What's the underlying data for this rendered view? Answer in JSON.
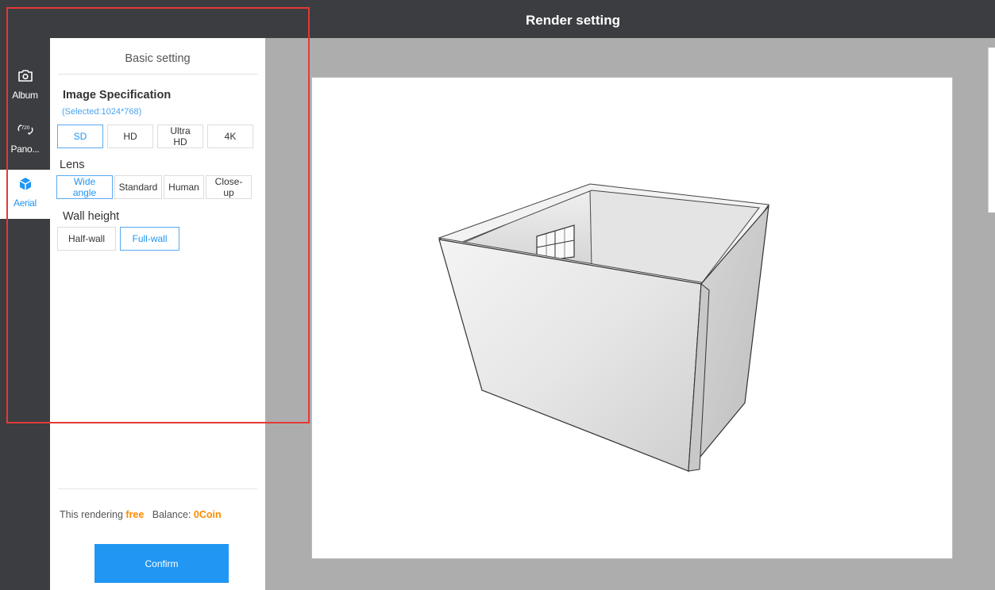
{
  "header": {
    "title": "Render setting"
  },
  "nav": {
    "items": [
      {
        "label": "Album",
        "icon": "camera-icon"
      },
      {
        "label": "Pano...",
        "icon": "rotate-720-icon",
        "icon_text": "720"
      },
      {
        "label": "Aerial",
        "icon": "cube-icon"
      }
    ],
    "active_index": 2
  },
  "panel": {
    "title": "Basic setting",
    "image_spec": {
      "heading": "Image Specification",
      "selected_note": "(Selected:1024*768)",
      "options": [
        "SD",
        "HD",
        "Ultra HD",
        "4K"
      ],
      "selected": "SD"
    },
    "lens": {
      "heading": "Lens",
      "options": [
        "Wide angle",
        "Standard",
        "Human",
        "Close-up"
      ],
      "selected": "Wide angle"
    },
    "wall_height": {
      "heading": "Wall height",
      "options": [
        "Half-wall",
        "Full-wall"
      ],
      "selected": "Full-wall"
    }
  },
  "footer": {
    "prefix": "This rendering",
    "price": "free",
    "balance_label": "Balance:",
    "balance_value": "0Coin",
    "confirm_label": "Confirm"
  },
  "colors": {
    "accent": "#2196f3",
    "sidebar": "#3b3d40",
    "highlight": "#e53935",
    "price": "#ff8a00"
  }
}
